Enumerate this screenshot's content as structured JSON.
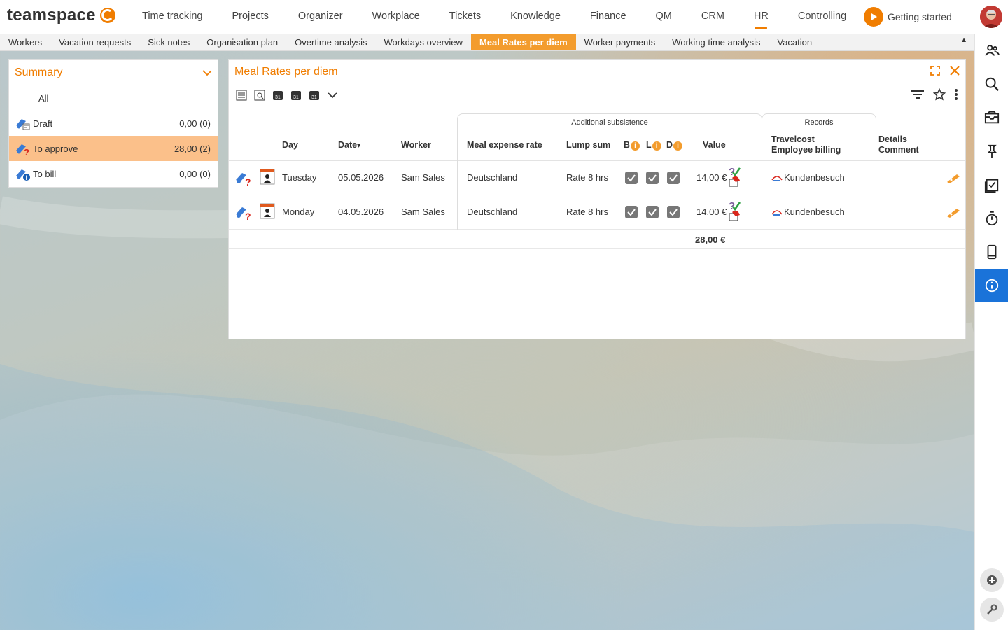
{
  "app": {
    "logo_text": "teamspace",
    "nav": [
      "Time tracking",
      "Projects",
      "Organizer",
      "Workplace",
      "Tickets",
      "Knowledge",
      "Finance",
      "QM",
      "CRM",
      "HR",
      "Controlling"
    ],
    "active_nav": "HR",
    "getting_started": "Getting started",
    "accent_color": "#f07d00",
    "active_blue": "#1a73d9"
  },
  "subtabs": [
    "Workers",
    "Vacation requests",
    "Sick notes",
    "Organisation plan",
    "Overtime analysis",
    "Workdays overview",
    "Meal Rates per diem",
    "Worker payments",
    "Working time analysis",
    "Vacation"
  ],
  "active_subtab": "Meal Rates per diem",
  "summary": {
    "title": "Summary",
    "rows": [
      {
        "label": "All",
        "value": ""
      },
      {
        "label": "Draft",
        "value": "0,00 (0)"
      },
      {
        "label": "To approve",
        "value": "28,00 (2)"
      },
      {
        "label": "To bill",
        "value": "0,00 (0)"
      }
    ]
  },
  "panel": {
    "title": "Meal Rates per diem",
    "groups": {
      "additional": "Additional subsistence",
      "records": "Records"
    },
    "headers": {
      "day": "Day",
      "date": "Date",
      "date_sort": "▾",
      "worker": "Worker",
      "meal_rate": "Meal expense rate",
      "lump_sum": "Lump sum",
      "b": "B",
      "l": "L",
      "d": "D",
      "info_symbol": "i",
      "value": "Value",
      "travelcost": "Travelcost",
      "employee_billing": "Employee billing",
      "details": "Details",
      "comment": "Comment"
    },
    "rows": [
      {
        "day": "Tuesday",
        "date": "05.05.2026",
        "worker": "Sam Sales",
        "meal_rate": "Deutschland",
        "lump_sum": "Rate 8 hrs",
        "b": true,
        "l": true,
        "d": true,
        "value": "14,00 €",
        "travelcost": "Kundenbesuch"
      },
      {
        "day": "Monday",
        "date": "04.05.2026",
        "worker": "Sam Sales",
        "meal_rate": "Deutschland",
        "lump_sum": "Rate 8 hrs",
        "b": true,
        "l": true,
        "d": true,
        "value": "14,00 €",
        "travelcost": "Kundenbesuch"
      }
    ],
    "total": "28,00 €"
  },
  "icons": {
    "rightbar": [
      "people-icon",
      "search-icon",
      "inbox-icon",
      "pin-icon",
      "calendar-check-icon",
      "stopwatch-icon",
      "mobile-icon",
      "info-icon"
    ],
    "rightbar_bottom": [
      "add-circle-icon",
      "wrench-icon"
    ]
  }
}
